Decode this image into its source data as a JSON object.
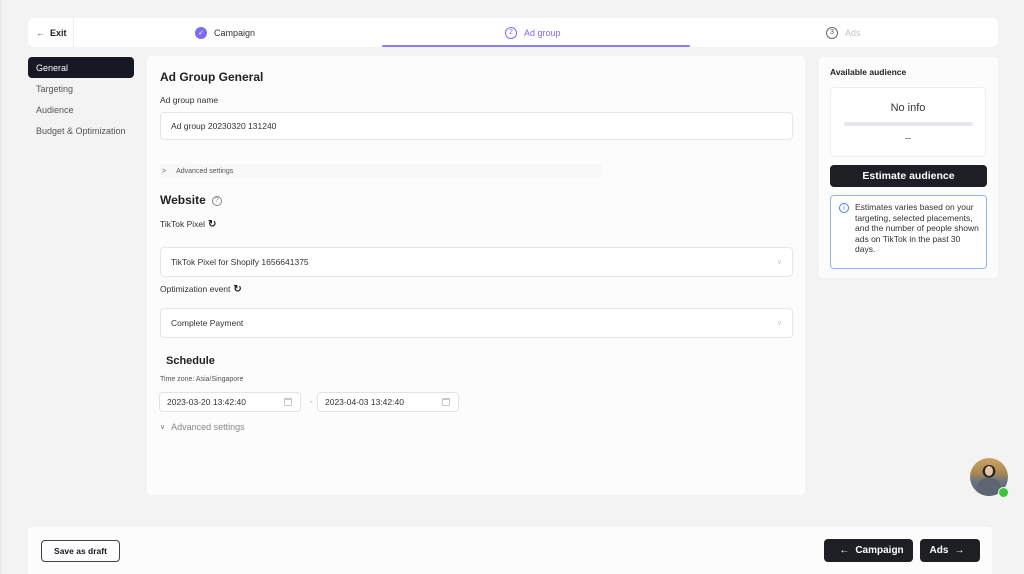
{
  "topbar": {
    "exit_label": "Exit",
    "steps": [
      {
        "number": "✓",
        "label": "Campaign",
        "state": "completed"
      },
      {
        "number": "2",
        "label": "Ad group",
        "state": "active"
      },
      {
        "number": "3",
        "label": "Ads",
        "state": "upcoming"
      }
    ]
  },
  "leftnav": {
    "items": [
      {
        "label": "General",
        "active": true
      },
      {
        "label": "Targeting",
        "active": false
      },
      {
        "label": "Audience",
        "active": false
      },
      {
        "label": "Budget & Optimization",
        "active": false
      }
    ]
  },
  "main": {
    "section_title": "Ad Group General",
    "ad_group_name_label": "Ad group name",
    "ad_group_name_value": "Ad group 20230320 131240",
    "advanced_settings_1": "Advanced settings",
    "website_title": "Website",
    "help_glyph": "?",
    "tiktok_pixel_label": "TikTok Pixel",
    "tiktok_pixel_value": "TikTok Pixel for Shopify 1656641375",
    "optimization_event_label": "Optimization event",
    "optimization_event_value": "Complete Payment",
    "schedule_title": "Schedule",
    "timezone": "Time zone: Asia/Singapore",
    "start_date": "2023-03-20 13:42:40",
    "end_date": "2023-04-03 13:42:40",
    "date_separator": "-",
    "advanced_settings_2": "Advanced settings"
  },
  "audience": {
    "title": "Available audience",
    "no_info": "No info",
    "value": "--",
    "estimate_button": "Estimate audience",
    "info_text": "Estimates varies based on your targeting, selected placements, and the number of people shown ads on TikTok in the past 30 days.",
    "colors": {
      "info_border": "#8fb6f0",
      "info_icon": "#3d7ff0"
    }
  },
  "footer": {
    "save_draft": "Save as draft",
    "prev_button": "Campaign",
    "next_button": "Ads"
  },
  "colors": {
    "accent": "#7b6cf2",
    "dark_button": "#1e1f23",
    "online_status": "#3cc43c"
  }
}
